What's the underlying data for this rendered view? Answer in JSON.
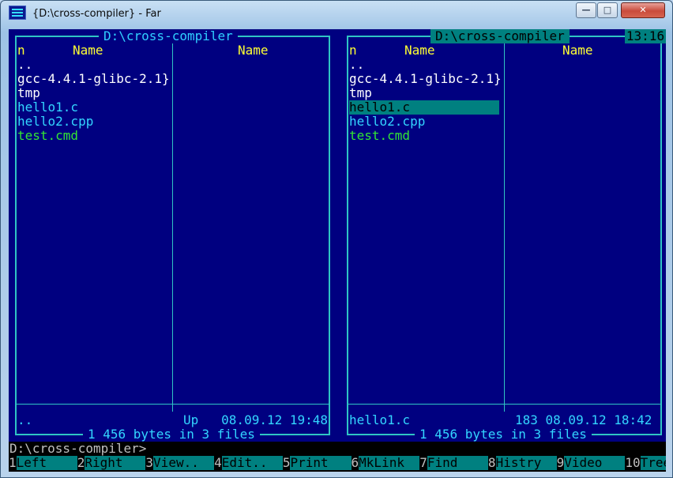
{
  "window": {
    "title": "{D:\\cross-compiler} - Far",
    "minimize": "—",
    "maximize": "□",
    "close": "✕"
  },
  "left_panel": {
    "title": "D:\\cross-compiler",
    "col_n": "n",
    "col_name1": "Name",
    "col_name2": "Name",
    "files": [
      {
        "name": "..",
        "kind": "dir"
      },
      {
        "name": "gcc-4.4.1-glibc-2.1}",
        "kind": "dir"
      },
      {
        "name": "tmp",
        "kind": "dir"
      },
      {
        "name": "hello1.c",
        "kind": "src"
      },
      {
        "name": "hello2.cpp",
        "kind": "src"
      },
      {
        "name": "test.cmd",
        "kind": "cmd"
      }
    ],
    "status_name": "..",
    "status_info": "Up   08.09.12 19:48",
    "summary": "1 456 bytes in 3 files"
  },
  "right_panel": {
    "title": "D:\\cross-compiler",
    "col_n": "n",
    "col_name1": "Name",
    "col_name2": "Name",
    "files": [
      {
        "name": "..",
        "kind": "dir"
      },
      {
        "name": "gcc-4.4.1-glibc-2.1}",
        "kind": "dir"
      },
      {
        "name": "tmp",
        "kind": "dir"
      },
      {
        "name": "hello1.c",
        "kind": "sel"
      },
      {
        "name": "hello2.cpp",
        "kind": "src"
      },
      {
        "name": "test.cmd",
        "kind": "cmd"
      }
    ],
    "status_name": "hello1.c",
    "status_info": "183 08.09.12 18:42",
    "summary": "1 456 bytes in 3 files"
  },
  "clock": "13:16",
  "command_line": "D:\\cross-compiler>",
  "keybar": [
    {
      "num": "1",
      "label": "Left    "
    },
    {
      "num": "2",
      "label": "Right   "
    },
    {
      "num": "3",
      "label": "View..  "
    },
    {
      "num": "4",
      "label": "Edit..  "
    },
    {
      "num": "5",
      "label": "Print   "
    },
    {
      "num": "6",
      "label": "MkLink  "
    },
    {
      "num": "7",
      "label": "Find    "
    },
    {
      "num": "8",
      "label": "Histry  "
    },
    {
      "num": "9",
      "label": "Video   "
    },
    {
      "num": "10",
      "label": "Tree   "
    }
  ],
  "colors": {
    "background": "#000080",
    "frame": "#2fc4c4",
    "header": "#ffff33",
    "highlight": "#008080"
  }
}
